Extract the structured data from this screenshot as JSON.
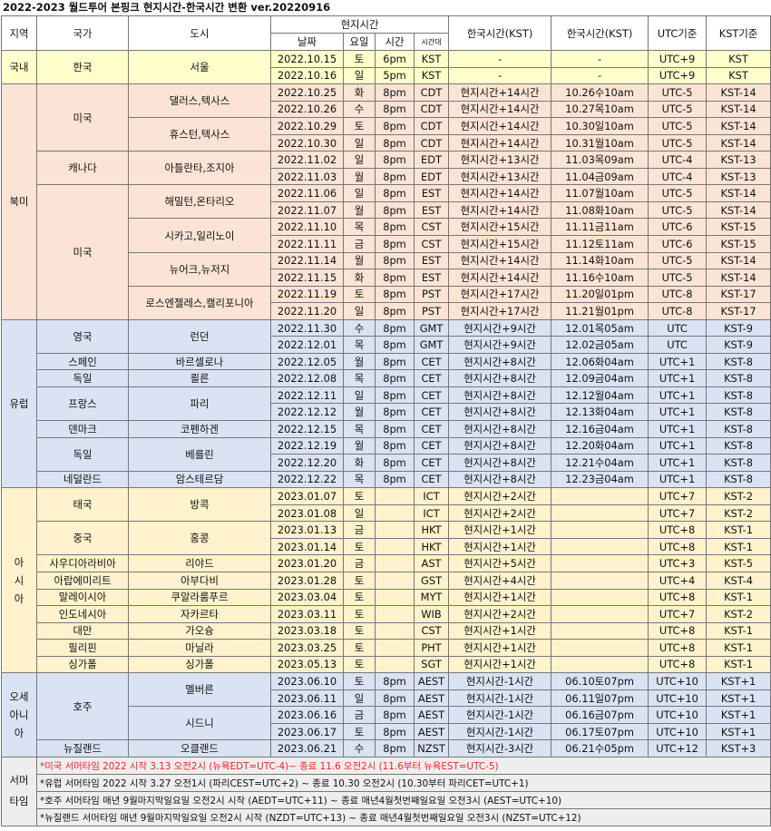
{
  "title": "2022-2023 월드투어  본핑크 현지시간-한국시간 변환 ver.20220916",
  "headers": {
    "region": "지역",
    "country": "국가",
    "city": "도시",
    "local_time": "현지시간",
    "date": "날짜",
    "day": "요일",
    "time": "시간",
    "tz": "시간대",
    "kst_diff": "한국시간(KST)",
    "kst_time": "한국시간(KST)",
    "utc_base": "UTC기준",
    "kst_base": "KST기준"
  },
  "regions": [
    {
      "name": "국내"
    },
    {
      "name": "북미"
    },
    {
      "name": "유럽"
    },
    {
      "name": "아\n시\n아"
    },
    {
      "name": "오세\n아니\n아"
    }
  ],
  "countries": [
    {
      "name": "한국"
    },
    {
      "name": "미국"
    },
    {
      "name": "캐나다"
    },
    {
      "name": "미국"
    },
    {
      "name": "영국"
    },
    {
      "name": "스페인"
    },
    {
      "name": "독일"
    },
    {
      "name": "프랑스"
    },
    {
      "name": "덴마크"
    },
    {
      "name": "독일"
    },
    {
      "name": "네덜란드"
    },
    {
      "name": "태국"
    },
    {
      "name": "중국"
    },
    {
      "name": "사우디아라비아"
    },
    {
      "name": "아랍에미리트"
    },
    {
      "name": "말레이시아"
    },
    {
      "name": "인도네시아"
    },
    {
      "name": "대만"
    },
    {
      "name": "필리핀"
    },
    {
      "name": "싱가폴"
    },
    {
      "name": "호주"
    },
    {
      "name": "뉴질랜드"
    }
  ],
  "cities": [
    {
      "name": "서울"
    },
    {
      "name": "댈러스,텍사스"
    },
    {
      "name": "휴스턴,텍사스"
    },
    {
      "name": "아틀란타,조지아"
    },
    {
      "name": "해밀턴,온타리오"
    },
    {
      "name": "시카고,일리노이"
    },
    {
      "name": "뉴어크,뉴저지"
    },
    {
      "name": "로스엔젤레스,캘리포니아"
    },
    {
      "name": "런던"
    },
    {
      "name": "바르셀로나"
    },
    {
      "name": "쾰른"
    },
    {
      "name": "파리"
    },
    {
      "name": "코펜하겐"
    },
    {
      "name": "베를린"
    },
    {
      "name": "암스테르담"
    },
    {
      "name": "방콕"
    },
    {
      "name": "홍콩"
    },
    {
      "name": "리야드"
    },
    {
      "name": "아부다비"
    },
    {
      "name": "쿠알라룸푸르"
    },
    {
      "name": "자카르타"
    },
    {
      "name": "가오슝"
    },
    {
      "name": "마닐라"
    },
    {
      "name": "싱가폴"
    },
    {
      "name": "멜버른"
    },
    {
      "name": "시드니"
    },
    {
      "name": "오클랜드"
    }
  ],
  "rows": [
    {
      "date": "2022.10.15",
      "day": "토",
      "time": "6pm",
      "tz": "KST",
      "diff": "-",
      "kst": "-",
      "utc": "UTC+9",
      "kstb": "KST"
    },
    {
      "date": "2022.10.16",
      "day": "일",
      "time": "5pm",
      "tz": "KST",
      "diff": "-",
      "kst": "-",
      "utc": "UTC+9",
      "kstb": "KST"
    },
    {
      "date": "2022.10.25",
      "day": "화",
      "time": "8pm",
      "tz": "CDT",
      "diff": "현지시간+14시간",
      "kst": "10.26수10am",
      "utc": "UTC-5",
      "kstb": "KST-14"
    },
    {
      "date": "2022.10.26",
      "day": "수",
      "time": "8pm",
      "tz": "CDT",
      "diff": "현지시간+14시간",
      "kst": "10.27목10am",
      "utc": "UTC-5",
      "kstb": "KST-14"
    },
    {
      "date": "2022.10.29",
      "day": "토",
      "time": "8pm",
      "tz": "CDT",
      "diff": "현지시간+14시간",
      "kst": "10.30일10am",
      "utc": "UTC-5",
      "kstb": "KST-14"
    },
    {
      "date": "2022.10.30",
      "day": "일",
      "time": "8pm",
      "tz": "CDT",
      "diff": "현지시간+14시간",
      "kst": "10.31월10am",
      "utc": "UTC-5",
      "kstb": "KST-14"
    },
    {
      "date": "2022.11.02",
      "day": "일",
      "time": "8pm",
      "tz": "EDT",
      "diff": "현지시간+13시간",
      "kst": "11.03목09am",
      "utc": "UTC-4",
      "kstb": "KST-13"
    },
    {
      "date": "2022.11.03",
      "day": "월",
      "time": "8pm",
      "tz": "EDT",
      "diff": "현지시간+13시간",
      "kst": "11.04금09am",
      "utc": "UTC-4",
      "kstb": "KST-13"
    },
    {
      "date": "2022.11.06",
      "day": "일",
      "time": "8pm",
      "tz": "EST",
      "diff": "현지시간+14시간",
      "kst": "11.07월10am",
      "utc": "UTC-5",
      "kstb": "KST-14"
    },
    {
      "date": "2022.11.07",
      "day": "월",
      "time": "8pm",
      "tz": "EST",
      "diff": "현지시간+14시간",
      "kst": "11.08화10am",
      "utc": "UTC-5",
      "kstb": "KST-14"
    },
    {
      "date": "2022.11.10",
      "day": "목",
      "time": "8pm",
      "tz": "CST",
      "diff": "현지시간+15시간",
      "kst": "11.11금11am",
      "utc": "UTC-6",
      "kstb": "KST-15"
    },
    {
      "date": "2022.11.11",
      "day": "금",
      "time": "8pm",
      "tz": "CST",
      "diff": "현지시간+15시간",
      "kst": "11.12토11am",
      "utc": "UTC-6",
      "kstb": "KST-15"
    },
    {
      "date": "2022.11.14",
      "day": "월",
      "time": "8pm",
      "tz": "EST",
      "diff": "현지시간+14시간",
      "kst": "11.14화10am",
      "utc": "UTC-5",
      "kstb": "KST-14"
    },
    {
      "date": "2022.11.15",
      "day": "화",
      "time": "8pm",
      "tz": "EST",
      "diff": "현지시간+14시간",
      "kst": "11.16수10am",
      "utc": "UTC-5",
      "kstb": "KST-14"
    },
    {
      "date": "2022.11.19",
      "day": "토",
      "time": "8pm",
      "tz": "PST",
      "diff": "현지시간+17시간",
      "kst": "11.20일01pm",
      "utc": "UTC-8",
      "kstb": "KST-17"
    },
    {
      "date": "2022.11.20",
      "day": "일",
      "time": "8pm",
      "tz": "PST",
      "diff": "현지시간+17시간",
      "kst": "11.21월01pm",
      "utc": "UTC-8",
      "kstb": "KST-17"
    },
    {
      "date": "2022.11.30",
      "day": "수",
      "time": "8pm",
      "tz": "GMT",
      "diff": "현지시간+9시간",
      "kst": "12.01목05am",
      "utc": "UTC",
      "kstb": "KST-9"
    },
    {
      "date": "2022.12.01",
      "day": "목",
      "time": "8pm",
      "tz": "GMT",
      "diff": "현지시간+9시간",
      "kst": "12.02금05am",
      "utc": "UTC",
      "kstb": "KST-9"
    },
    {
      "date": "2022.12.05",
      "day": "월",
      "time": "8pm",
      "tz": "CET",
      "diff": "현지시간+8시간",
      "kst": "12.06화04am",
      "utc": "UTC+1",
      "kstb": "KST-8"
    },
    {
      "date": "2022.12.08",
      "day": "목",
      "time": "8pm",
      "tz": "CET",
      "diff": "현지시간+8시간",
      "kst": "12.09금04am",
      "utc": "UTC+1",
      "kstb": "KST-8"
    },
    {
      "date": "2022.12.11",
      "day": "일",
      "time": "8pm",
      "tz": "CET",
      "diff": "현지시간+8시간",
      "kst": "12.12월04am",
      "utc": "UTC+1",
      "kstb": "KST-8"
    },
    {
      "date": "2022.12.12",
      "day": "월",
      "time": "8pm",
      "tz": "CET",
      "diff": "현지시간+8시간",
      "kst": "12.13화04am",
      "utc": "UTC+1",
      "kstb": "KST-8"
    },
    {
      "date": "2022.12.15",
      "day": "목",
      "time": "8pm",
      "tz": "CET",
      "diff": "현지시간+8시간",
      "kst": "12.16금04am",
      "utc": "UTC+1",
      "kstb": "KST-8"
    },
    {
      "date": "2022.12.19",
      "day": "월",
      "time": "8pm",
      "tz": "CET",
      "diff": "현지시간+8시간",
      "kst": "12.20화04am",
      "utc": "UTC+1",
      "kstb": "KST-8"
    },
    {
      "date": "2022.12.20",
      "day": "화",
      "time": "8pm",
      "tz": "CET",
      "diff": "현지시간+8시간",
      "kst": "12.21수04am",
      "utc": "UTC+1",
      "kstb": "KST-8"
    },
    {
      "date": "2022.12.22",
      "day": "목",
      "time": "8pm",
      "tz": "CET",
      "diff": "현지시간+8시간",
      "kst": "12.23금04am",
      "utc": "UTC+1",
      "kstb": "KST-8"
    },
    {
      "date": "2023.01.07",
      "day": "토",
      "time": "",
      "tz": "ICT",
      "diff": "현지시간+2시간",
      "kst": "",
      "utc": "UTC+7",
      "kstb": "KST-2"
    },
    {
      "date": "2023.01.08",
      "day": "일",
      "time": "",
      "tz": "ICT",
      "diff": "현지시간+2시간",
      "kst": "",
      "utc": "UTC+7",
      "kstb": "KST-2"
    },
    {
      "date": "2023.01.13",
      "day": "금",
      "time": "",
      "tz": "HKT",
      "diff": "현지시간+1시간",
      "kst": "",
      "utc": "UTC+8",
      "kstb": "KST-1"
    },
    {
      "date": "2023.01.14",
      "day": "토",
      "time": "",
      "tz": "HKT",
      "diff": "현지시간+1시간",
      "kst": "",
      "utc": "UTC+8",
      "kstb": "KST-1"
    },
    {
      "date": "2023.01.20",
      "day": "금",
      "time": "",
      "tz": "AST",
      "diff": "현지시간+5시간",
      "kst": "",
      "utc": "UTC+3",
      "kstb": "KST-5"
    },
    {
      "date": "2023.01.28",
      "day": "토",
      "time": "",
      "tz": "GST",
      "diff": "현지시간+4시간",
      "kst": "",
      "utc": "UTC+4",
      "kstb": "KST-4"
    },
    {
      "date": "2023.03.04",
      "day": "토",
      "time": "",
      "tz": "MYT",
      "diff": "현지시간+1시간",
      "kst": "",
      "utc": "UTC+8",
      "kstb": "KST-1"
    },
    {
      "date": "2023.03.11",
      "day": "토",
      "time": "",
      "tz": "WIB",
      "diff": "현지시간+2시간",
      "kst": "",
      "utc": "UTC+7",
      "kstb": "KST-2"
    },
    {
      "date": "2023.03.18",
      "day": "토",
      "time": "",
      "tz": "CST",
      "diff": "현지시간+1시간",
      "kst": "",
      "utc": "UTC+8",
      "kstb": "KST-1"
    },
    {
      "date": "2023.03.25",
      "day": "토",
      "time": "",
      "tz": "PHT",
      "diff": "현지시간+1시간",
      "kst": "",
      "utc": "UTC+8",
      "kstb": "KST-1"
    },
    {
      "date": "2023.05.13",
      "day": "토",
      "time": "",
      "tz": "SGT",
      "diff": "현지시간+1시간",
      "kst": "",
      "utc": "UTC+8",
      "kstb": "KST-1"
    },
    {
      "date": "2023.06.10",
      "day": "토",
      "time": "8pm",
      "tz": "AEST",
      "diff": "현지시간-1시간",
      "kst": "06.10토07pm",
      "utc": "UTC+10",
      "kstb": "KST+1"
    },
    {
      "date": "2023.06.11",
      "day": "일",
      "time": "8pm",
      "tz": "AEST",
      "diff": "현지시간-1시간",
      "kst": "06.11일07pm",
      "utc": "UTC+10",
      "kstb": "KST+1"
    },
    {
      "date": "2023.06.16",
      "day": "금",
      "time": "8pm",
      "tz": "AEST",
      "diff": "현지시간-1시간",
      "kst": "06.16금07pm",
      "utc": "UTC+10",
      "kstb": "KST+1"
    },
    {
      "date": "2023.06.17",
      "day": "토",
      "time": "8pm",
      "tz": "AEST",
      "diff": "현지시간-1시간",
      "kst": "06.17토07pm",
      "utc": "UTC+10",
      "kstb": "KST+1"
    },
    {
      "date": "2023.06.21",
      "day": "수",
      "time": "8pm",
      "tz": "NZST",
      "diff": "현지시간-3시간",
      "kst": "06.21수05pm",
      "utc": "UTC+12",
      "kstb": "KST+3"
    }
  ],
  "notes": {
    "label": "서머\n타임",
    "items": [
      "*미국 서머타임 2022 시작 3.13 오전2시 (뉴욕EDT=UTC-4)~ 종료 11.6 오전2시 (11.6부터 뉴욕EST=UTC-5)",
      "*유럽 서머타임 2022 시작 3.27 오전1시 (파리CEST=UTC+2) ~ 종료 10.30 오전2시 (10.30부터 파리CET=UTC+1)",
      "*호주 서머타임 매년 9월마지막일요일 오전2시 시작 (AEDT=UTC+11) ~ 종료 매년4월첫번째일요일 오전3시 (AEST=UTC+10)",
      "*뉴질랜드 서머타임 매년 9월마지막일요일 오전2시 시작 (NZDT=UTC+13) ~ 종료 매년4월첫번째일요일 오전3시 (NZST=UTC+12)"
    ]
  },
  "colors": {
    "domestic": "#ffffcc",
    "north_america": "#fbe4d5",
    "europe": "#dae3f3",
    "asia": "#fff2cc",
    "oceania": "#dae3f3",
    "notes_bg": "#eeeeee",
    "note_red": "#e8262a"
  }
}
